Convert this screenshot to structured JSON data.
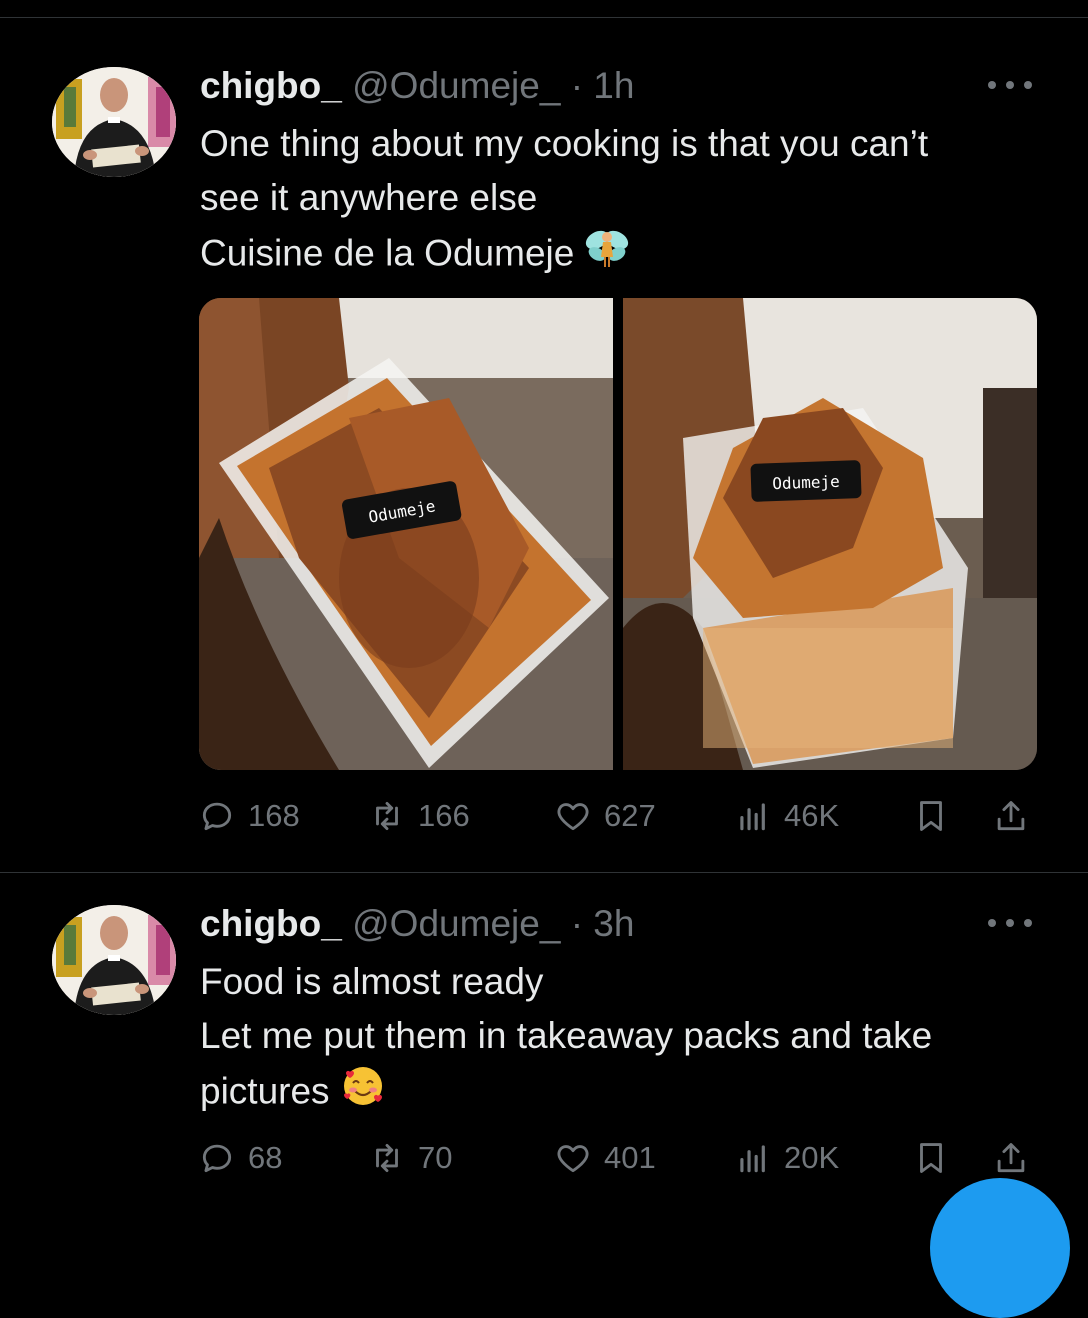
{
  "tweets": [
    {
      "name": "chigbo_",
      "handle": "@Odumeje_",
      "separator": "·",
      "time": "1h",
      "lines": [
        "One thing about my cooking is that you can’t",
        "see it anywhere else",
        "Cuisine de la Odumeje"
      ],
      "emoji": "fairy",
      "media": [
        {
          "sticker": "Odumeje"
        },
        {
          "sticker": "Odumeje"
        }
      ],
      "stats": {
        "replies": "168",
        "reposts": "166",
        "likes": "627",
        "views": "46K"
      }
    },
    {
      "name": "chigbo_",
      "handle": "@Odumeje_",
      "separator": "·",
      "time": "3h",
      "lines": [
        "Food is almost ready",
        "Let me put them in takeaway packs and take",
        "pictures"
      ],
      "emoji": "smiling-face-with-hearts",
      "stats": {
        "replies": "68",
        "reposts": "70",
        "likes": "401",
        "views": "20K"
      }
    }
  ],
  "colors": {
    "background": "#000000",
    "text": "#e7e9ea",
    "muted": "#71767b",
    "divider": "#2f3336",
    "accent": "#1d9bf0"
  }
}
